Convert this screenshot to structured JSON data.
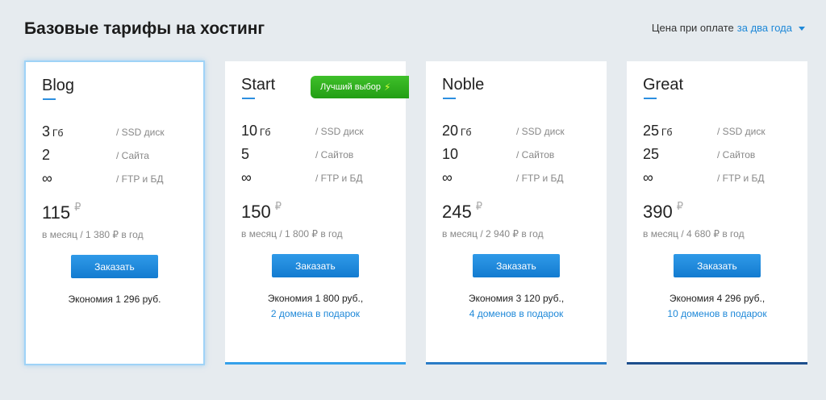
{
  "header": {
    "title": "Базовые тарифы на хостинг",
    "price_label": "Цена при оплате",
    "price_period": "за два года"
  },
  "plans": [
    {
      "name": "Blog",
      "disk_value": "3",
      "disk_unit": "Гб",
      "disk_label": "/ SSD диск",
      "sites_value": "2",
      "sites_label": "/ Сайта",
      "ftp_value": "∞",
      "ftp_label": "/ FTP и БД",
      "price": "115",
      "currency": "₽",
      "price_sub": "в месяц / 1 380 ₽ в год",
      "button": "Заказать",
      "saving": "Экономия 1 296 руб.",
      "gift": ""
    },
    {
      "name": "Start",
      "badge": "Лучший выбор",
      "disk_value": "10",
      "disk_unit": "Гб",
      "disk_label": "/ SSD диск",
      "sites_value": "5",
      "sites_label": "/ Сайтов",
      "ftp_value": "∞",
      "ftp_label": "/ FTP и БД",
      "price": "150",
      "currency": "₽",
      "price_sub": "в месяц / 1 800 ₽ в год",
      "button": "Заказать",
      "saving": "Экономия 1 800 руб.,",
      "gift": "2 домена в подарок"
    },
    {
      "name": "Noble",
      "disk_value": "20",
      "disk_unit": "Гб",
      "disk_label": "/ SSD диск",
      "sites_value": "10",
      "sites_label": "/ Сайтов",
      "ftp_value": "∞",
      "ftp_label": "/ FTP и БД",
      "price": "245",
      "currency": "₽",
      "price_sub": "в месяц / 2 940 ₽ в год",
      "button": "Заказать",
      "saving": "Экономия 3 120 руб.,",
      "gift": "4 доменов в подарок"
    },
    {
      "name": "Great",
      "disk_value": "25",
      "disk_unit": "Гб",
      "disk_label": "/ SSD диск",
      "sites_value": "25",
      "sites_label": "/ Сайтов",
      "ftp_value": "∞",
      "ftp_label": "/ FTP и БД",
      "price": "390",
      "currency": "₽",
      "price_sub": "в месяц / 4 680 ₽ в год",
      "button": "Заказать",
      "saving": "Экономия 4 296 руб.,",
      "gift": "10 доменов в подарок"
    }
  ],
  "colors": {
    "accent": "#1e88d8",
    "bar_start": "#35a0ea",
    "bar_noble": "#2a7cc6",
    "bar_great": "#1d4e8c",
    "badge": "#2fb11f"
  }
}
